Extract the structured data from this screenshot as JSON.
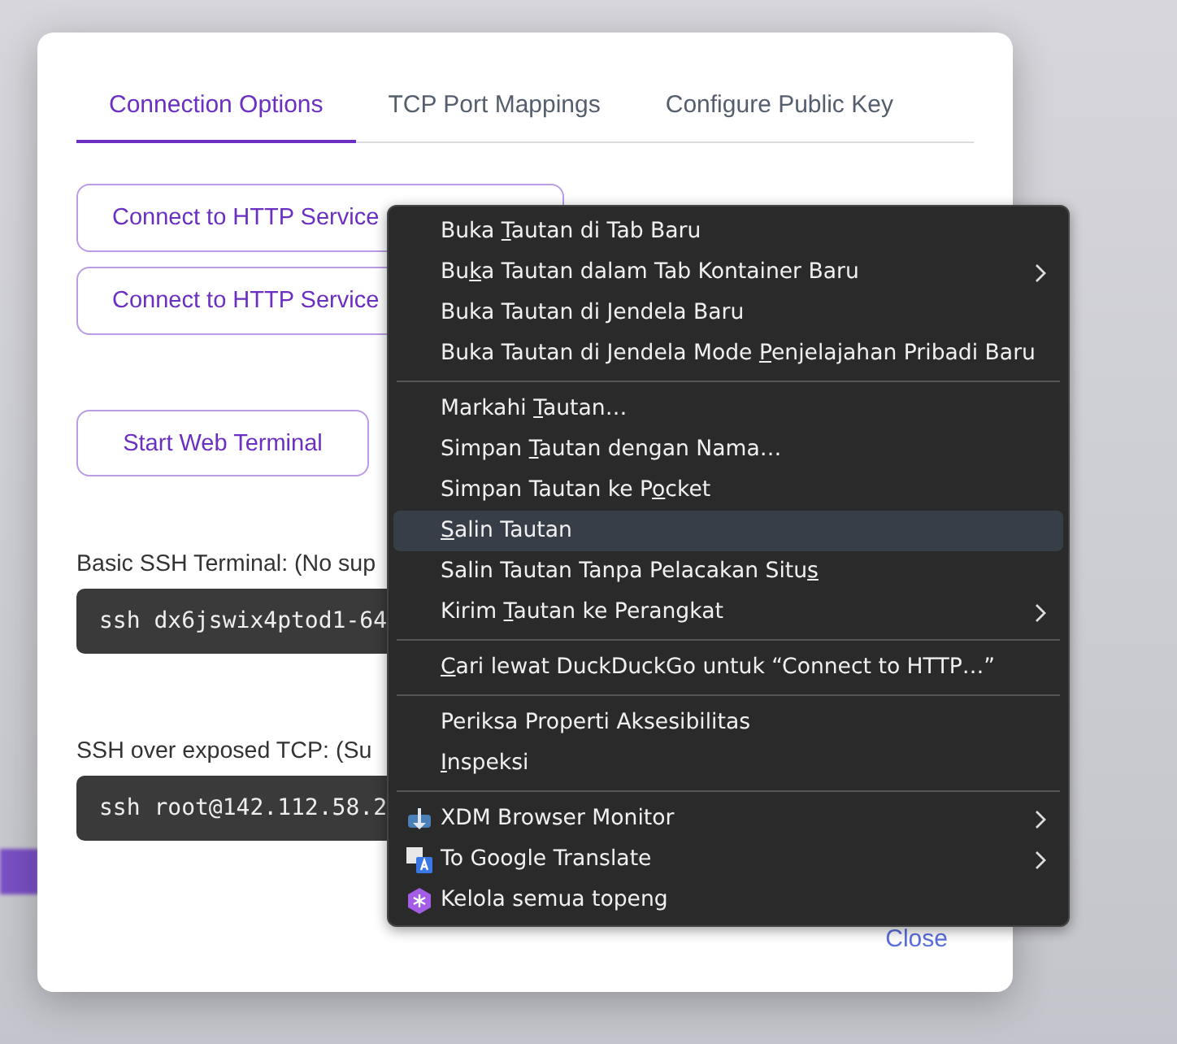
{
  "dialog": {
    "tabs": [
      {
        "label": "Connection Options",
        "selected": true
      },
      {
        "label": "TCP Port Mappings",
        "selected": false
      },
      {
        "label": "Configure Public Key",
        "selected": false
      }
    ],
    "service_buttons": [
      "Connect to HTTP Service",
      "Connect to HTTP Service"
    ],
    "terminal_button": "Start Web Terminal",
    "commands": [
      {
        "label": "Basic SSH Terminal: (No sup",
        "command": "ssh dx6jswix4ptod1-64"
      },
      {
        "label": "SSH over exposed TCP: (Su",
        "command": "ssh root@142.112.58.2"
      }
    ],
    "close": "Close"
  },
  "context_menu": {
    "groups": [
      [
        {
          "pre": "Buka ",
          "key": "T",
          "post": "autan di Tab Baru",
          "submenu": false,
          "selected": false
        },
        {
          "pre": "Bu",
          "key": "k",
          "post": "a Tautan dalam Tab Kontainer Baru",
          "submenu": true,
          "selected": false
        },
        {
          "pre": "Buka Tautan di Jendela Baru",
          "submenu": false,
          "selected": false
        },
        {
          "pre": "Buka Tautan di Jendela Mode ",
          "key": "P",
          "post": "enjelajahan Pribadi Baru",
          "submenu": false,
          "selected": false
        }
      ],
      [
        {
          "pre": "Markahi ",
          "key": "T",
          "post": "autan…",
          "submenu": false,
          "selected": false
        },
        {
          "pre": "Simpan ",
          "key": "T",
          "post": "autan dengan Nama…",
          "submenu": false,
          "selected": false
        },
        {
          "pre": "Simpan Tautan ke P",
          "key": "o",
          "post": "cket",
          "submenu": false,
          "selected": false
        },
        {
          "key": "S",
          "post": "alin Tautan",
          "submenu": false,
          "selected": true
        },
        {
          "pre": "Salin Tautan Tanpa Pelacakan Situ",
          "key": "s",
          "submenu": false,
          "selected": false
        },
        {
          "pre": "Kirim ",
          "key": "T",
          "post": "autan ke Perangkat",
          "submenu": true,
          "selected": false
        }
      ],
      [
        {
          "key": "C",
          "post": "ari lewat DuckDuckGo untuk “Connect to HTTP…”",
          "submenu": false,
          "selected": false
        }
      ],
      [
        {
          "pre": "Periksa Properti Aksesibilitas",
          "submenu": false,
          "selected": false
        },
        {
          "key": "I",
          "post": "nspeksi",
          "submenu": false,
          "selected": false
        }
      ],
      [
        {
          "pre": "XDM Browser Monitor",
          "submenu": true,
          "selected": false,
          "kind": "downloader"
        },
        {
          "pre": "To Google Translate",
          "submenu": true,
          "selected": false,
          "kind": "translator"
        },
        {
          "pre": "Kelola semua topeng",
          "submenu": false,
          "selected": false,
          "kind": "masks"
        }
      ]
    ]
  }
}
